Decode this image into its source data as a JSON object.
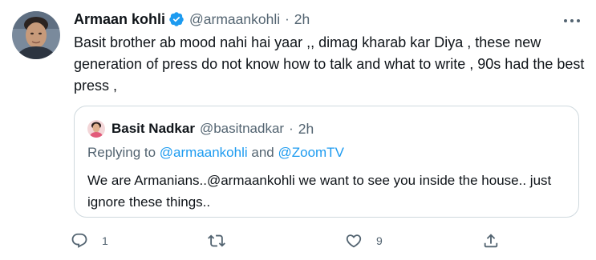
{
  "tweet": {
    "author_name": "Armaan kohli",
    "author_handle": "@armaankohli",
    "separator": "·",
    "time": "2h",
    "text": "Basit brother ab mood nahi hai yaar ,, dimag kharab kar Diya , these new generation of press do not know how to talk and what to write , 90s had the best press ,",
    "icons": {
      "avatar": "avatar-photo",
      "verified": "verified-badge-icon",
      "more": "more-options-icon"
    },
    "colors": {
      "verified": "#1d9bf0",
      "secondary": "#536471",
      "link": "#1d9bf0",
      "border": "#cfd9de"
    }
  },
  "quote": {
    "author_name": "Basit Nadkar",
    "author_handle": "@basitnadkar",
    "separator": "·",
    "time": "2h",
    "reply_prefix": "Replying to ",
    "reply_mention_1": "@armaankohli",
    "reply_and": " and ",
    "reply_mention_2": "@ZoomTV",
    "text": "We are Armanians..@armaankohli  we want to see you inside the house.. just ignore these things.."
  },
  "actions": {
    "reply": {
      "icon": "reply-icon",
      "count": "1"
    },
    "retweet": {
      "icon": "retweet-icon",
      "count": ""
    },
    "like": {
      "icon": "heart-icon",
      "count": "9"
    },
    "share": {
      "icon": "share-icon"
    }
  }
}
